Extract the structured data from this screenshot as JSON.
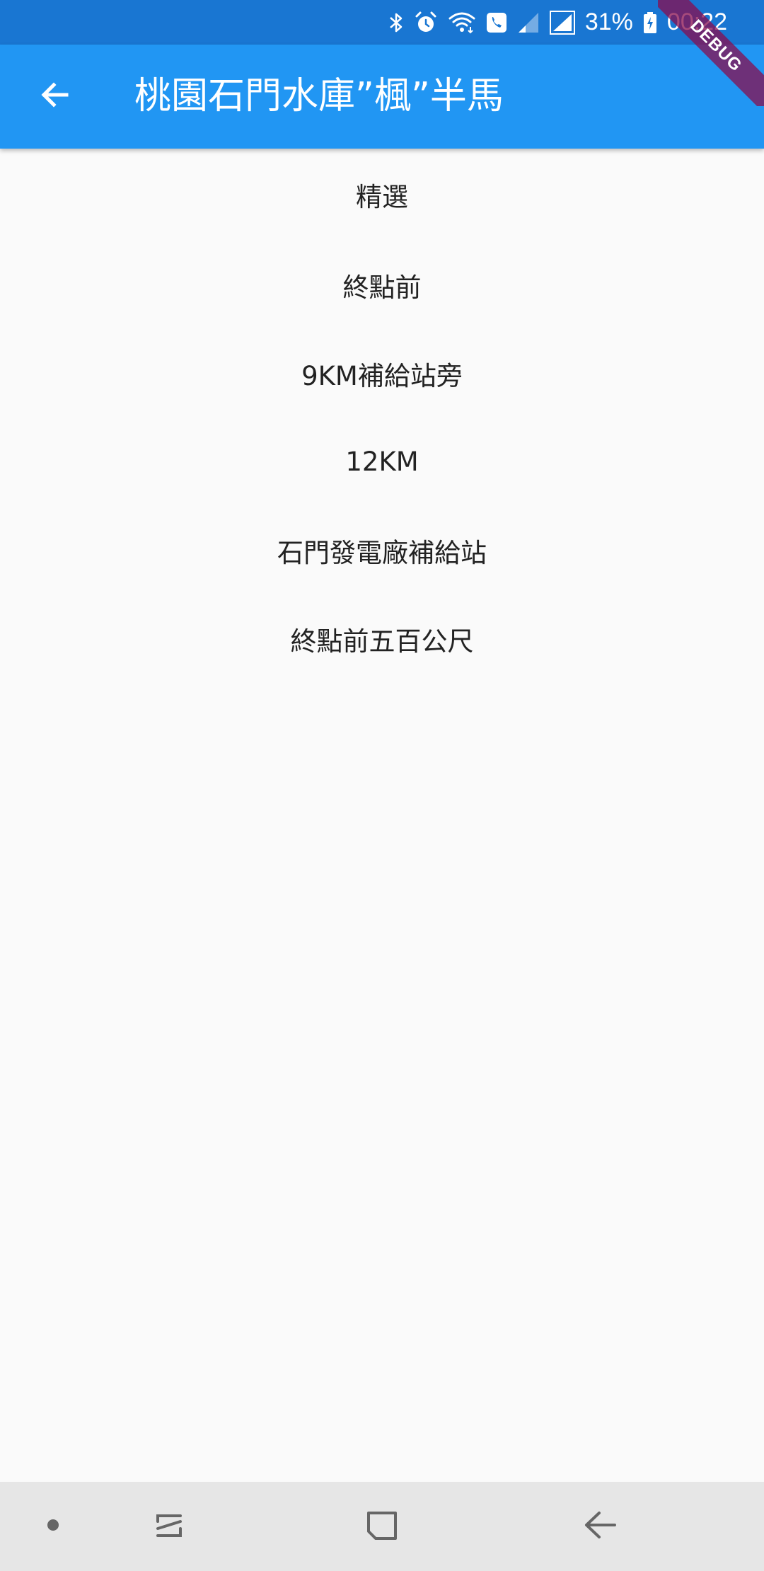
{
  "status_bar": {
    "battery_percent": "31%",
    "time": "00:22",
    "icons": [
      "bluetooth-icon",
      "alarm-icon",
      "wifi-icon",
      "wifi-call-icon",
      "signal-weak-icon",
      "signal-strong-icon",
      "battery-charging-icon"
    ]
  },
  "app_bar": {
    "title": "桃園石門水庫”楓”半馬",
    "back_icon": "arrow-back-icon",
    "background": "#2196f3"
  },
  "debug_banner": {
    "label": "DEBUG"
  },
  "list": {
    "items": [
      {
        "label": "精選"
      },
      {
        "label": "終點前"
      },
      {
        "label": "9KM補給站旁"
      },
      {
        "label": "12KM"
      },
      {
        "label": "石門發電廠補給站"
      },
      {
        "label": "終點前五百公尺"
      }
    ]
  },
  "nav_bar": {
    "buttons": [
      "dot-icon",
      "recent-apps-icon",
      "home-icon",
      "back-icon"
    ]
  },
  "colors": {
    "status_bar": "#1976d2",
    "app_bar": "#2196f3",
    "background": "#fafafa",
    "nav_bar": "#e6e6e6"
  }
}
